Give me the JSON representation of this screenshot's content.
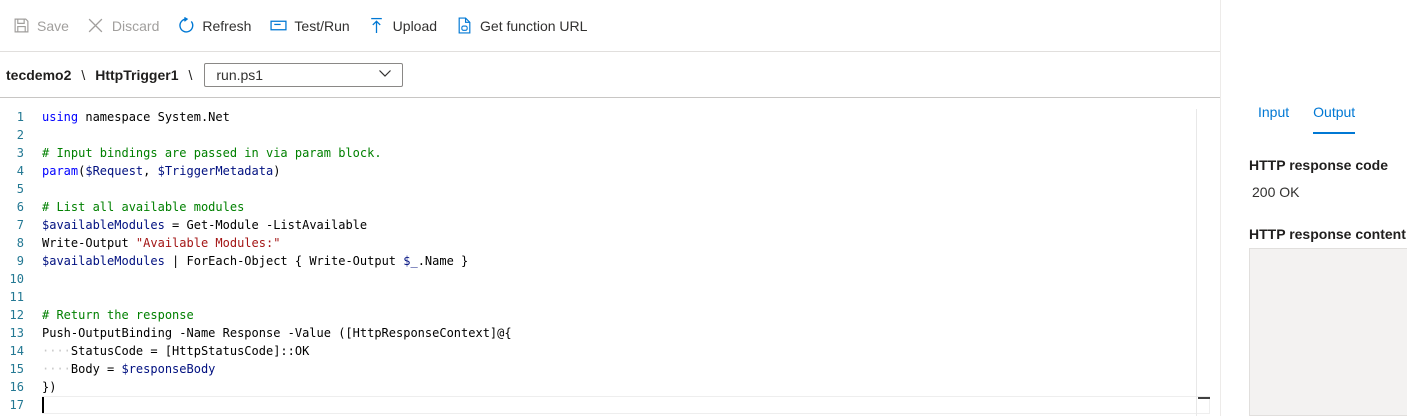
{
  "toolbar": {
    "save": "Save",
    "discard": "Discard",
    "refresh": "Refresh",
    "test_run": "Test/Run",
    "upload": "Upload",
    "get_function_url": "Get function URL"
  },
  "breadcrumb": {
    "app": "tecdemo2",
    "function": "HttpTrigger1",
    "separator": "\\",
    "file": "run.ps1"
  },
  "editor": {
    "line_numbers": [
      "1",
      "2",
      "3",
      "4",
      "5",
      "6",
      "7",
      "8",
      "9",
      "10",
      "11",
      "12",
      "13",
      "14",
      "15",
      "16",
      "17"
    ],
    "lines": [
      [
        {
          "t": "using",
          "c": "kw"
        },
        {
          "t": " namespace System.Net",
          "c": ""
        }
      ],
      [],
      [
        {
          "t": "# Input bindings are passed in via param block.",
          "c": "cm"
        }
      ],
      [
        {
          "t": "param",
          "c": "kw"
        },
        {
          "t": "(",
          "c": ""
        },
        {
          "t": "$Request",
          "c": "vr"
        },
        {
          "t": ", ",
          "c": ""
        },
        {
          "t": "$TriggerMetadata",
          "c": "vr"
        },
        {
          "t": ")",
          "c": ""
        }
      ],
      [],
      [
        {
          "t": "# List all available modules",
          "c": "cm"
        }
      ],
      [
        {
          "t": "$availableModules",
          "c": "vr"
        },
        {
          "t": " = Get-Module -ListAvailable",
          "c": ""
        }
      ],
      [
        {
          "t": "Write-Output ",
          "c": ""
        },
        {
          "t": "\"Available Modules:\"",
          "c": "st"
        }
      ],
      [
        {
          "t": "$availableModules",
          "c": "vr"
        },
        {
          "t": " | ForEach-Object { Write-Output ",
          "c": ""
        },
        {
          "t": "$_",
          "c": "vr"
        },
        {
          "t": ".Name }",
          "c": ""
        }
      ],
      [],
      [],
      [
        {
          "t": "# Return the response",
          "c": "cm"
        }
      ],
      [
        {
          "t": "Push-OutputBinding -Name Response -Value ([HttpResponseContext]@{",
          "c": ""
        }
      ],
      [
        {
          "t": "····",
          "c": "ws"
        },
        {
          "t": "StatusCode = [HttpStatusCode]::OK",
          "c": ""
        }
      ],
      [
        {
          "t": "····",
          "c": "ws"
        },
        {
          "t": "Body = ",
          "c": ""
        },
        {
          "t": "$responseBody",
          "c": "vr"
        }
      ],
      [
        {
          "t": "})",
          "c": ""
        }
      ],
      []
    ]
  },
  "panel": {
    "tabs": [
      "Input",
      "Output"
    ],
    "active_tab": "Output",
    "response_code_label": "HTTP response code",
    "response_code_value": "200 OK",
    "response_content_label": "HTTP response content"
  },
  "colors": {
    "accent": "#0078d4",
    "keyword": "#0000ff",
    "comment": "#008000",
    "variable": "#001080",
    "string": "#a31515"
  }
}
